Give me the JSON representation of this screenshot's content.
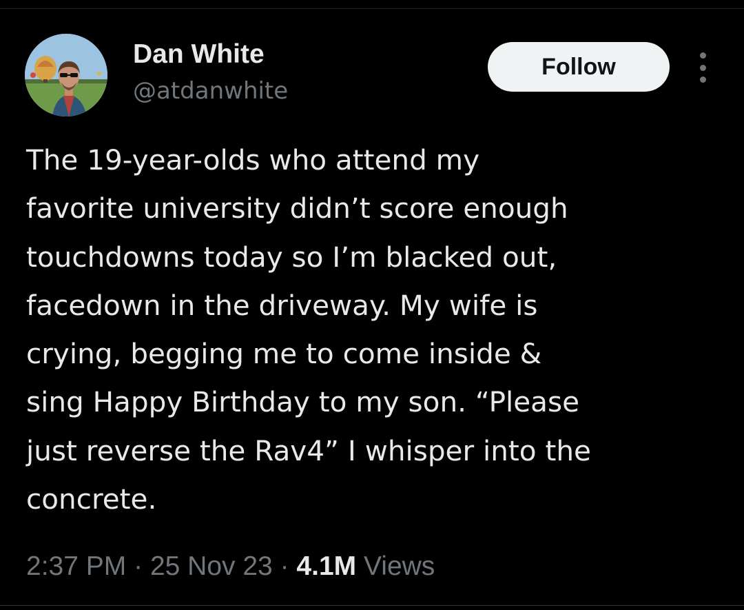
{
  "author": {
    "name": "Dan White",
    "handle": "@atdanwhite"
  },
  "follow_button": {
    "label": "Follow",
    "background": "#eff3f4",
    "text_color": "#0f1419"
  },
  "more_menu": {
    "icon": "more-vertical-icon"
  },
  "tweet": {
    "lines": [
      "The 19-year-olds who attend my",
      "favorite university didn’t score enough",
      "touchdowns today so I’m blacked out,",
      "facedown in the driveway. My wife is",
      "crying, begging me to come inside &",
      "sing Happy Birthday to my son. “Please",
      "just reverse the Rav4” I whisper into the",
      "concrete."
    ]
  },
  "meta": {
    "time": "2:37 PM",
    "separator": "·",
    "date": "25 Nov 23",
    "views_count": "4.1M",
    "views_label": "Views"
  },
  "colors": {
    "background": "#000000",
    "primary_text": "#e7e9ea",
    "secondary_text": "#71767b"
  }
}
